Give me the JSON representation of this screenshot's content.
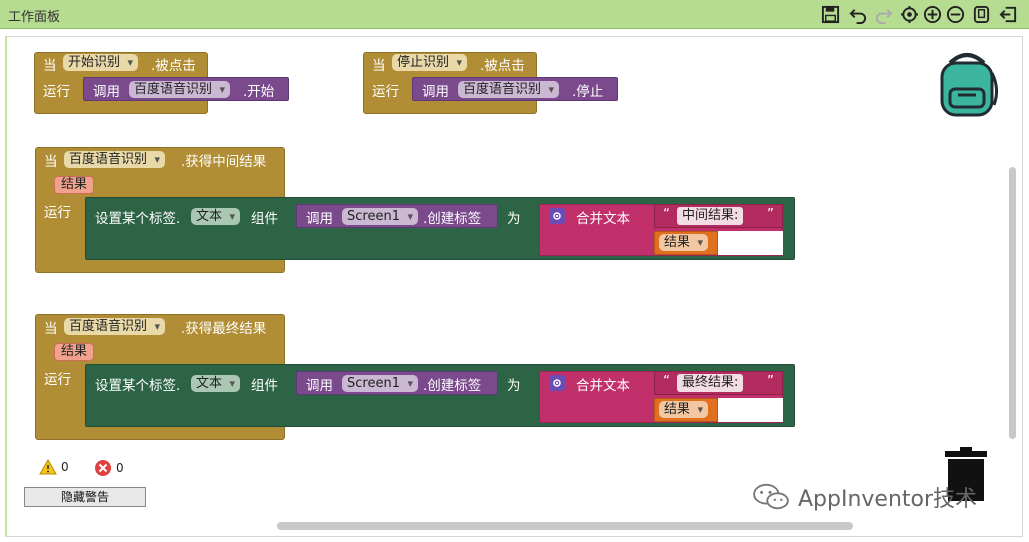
{
  "panel": {
    "title": "工作面板"
  },
  "toolbar": {
    "icons": [
      "save-icon",
      "undo-icon",
      "redo-icon",
      "center-icon",
      "zoom-in-icon",
      "zoom-out-icon",
      "download-icon",
      "exit-icon"
    ]
  },
  "blocks": {
    "when_label": "当",
    "do_label": "运行",
    "call_label": "调用",
    "click_event": ".被点击",
    "start_button": "开始识别",
    "stop_button": "停止识别",
    "baidu": "百度语音识别",
    "start_method": ".开始",
    "stop_method": ".停止",
    "partial_event": ".获得中间结果",
    "final_event": ".获得最终结果",
    "result_param": "结果",
    "set_label_prefix": "设置某个标签.",
    "text_prop": "文本",
    "component_label": "组件",
    "screen": "Screen1",
    "create_label": ".创建标签",
    "to_label": "为",
    "join_label": "合并文本",
    "partial_text": "中间结果:",
    "final_text": "最终结果:",
    "get_result": "结果"
  },
  "warnings": {
    "warning_count": "0",
    "error_count": "0",
    "hide_button": "隐藏警告"
  },
  "watermark": {
    "text": "AppInventor技术"
  },
  "colors": {
    "event": "#b18e35",
    "statement": "#2e6446",
    "call": "#7a4a8d",
    "text": "#b22c5f",
    "variable": "#e07020",
    "titlebar": "#b5dc90"
  }
}
